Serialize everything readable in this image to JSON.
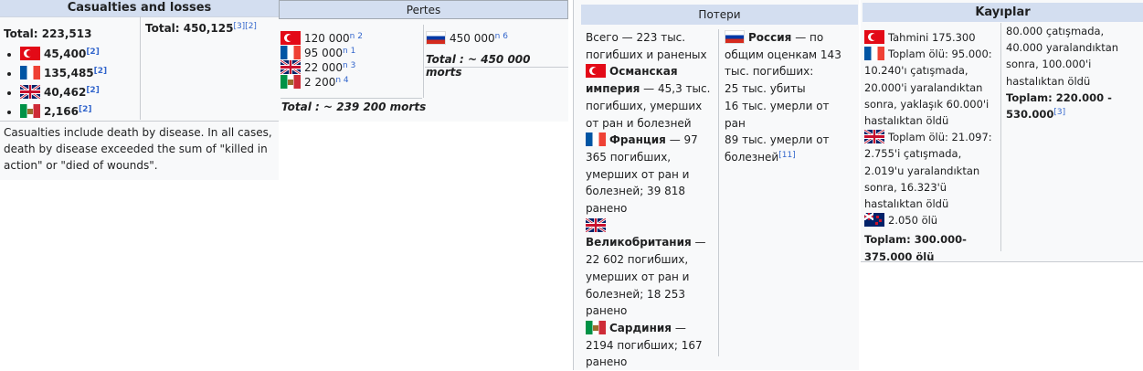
{
  "en": {
    "title": "Casualties and losses",
    "total_left_label": "Total:",
    "total_left_value": "223,513",
    "total_right_label": "Total:",
    "total_right_value": "450,125",
    "total_right_refs": "[3][2]",
    "rows": [
      {
        "flag": "turkey-flag",
        "value": "45,400",
        "ref": "[2]"
      },
      {
        "flag": "france-flag",
        "value": "135,485",
        "ref": "[2]"
      },
      {
        "flag": "uk-flag",
        "value": "40,462",
        "ref": "[2]"
      },
      {
        "flag": "sardinia-flag",
        "value": "2,166",
        "ref": "[2]"
      }
    ],
    "note": "Casualties include death by disease. In all cases, death by disease exceeded the sum of \"killed in action\" or \"died of wounds\"."
  },
  "fr": {
    "title": "Pertes",
    "rows": [
      {
        "flag": "turkey-flag",
        "value": "120 000",
        "ref": "n 2"
      },
      {
        "flag": "france-flag",
        "value": "95 000",
        "ref": "n 1"
      },
      {
        "flag": "uk-flag",
        "value": "22 000",
        "ref": "n 3"
      },
      {
        "flag": "sardinia-flag",
        "value": "2 200",
        "ref": "n 4"
      }
    ],
    "russia": {
      "flag": "russia-flag",
      "value": "450 000",
      "ref": "n 6"
    },
    "total_left": "Total : ~ 239 200 morts",
    "total_right": "Total : ~ 450 000 morts"
  },
  "ru": {
    "title": "Потери",
    "allies_total": "Всего — 223 тыс. погибших и раненых",
    "ottoman_name": "Османская империя",
    "ottoman_text": " — 45,3 тыс. погибших, умерших от ран и болезней",
    "france_name": "Франция",
    "france_text": " — 97 365 погибших, умерших от ран и болезней; 39 818 ранено",
    "uk_name": "Великобритания",
    "uk_text": " — 22 602 погибших, умерших от ран и болезней; 18 253 ранено",
    "sardinia_name": "Сардиния",
    "sardinia_text": " — 2194 погибших; 167 ранено",
    "russia_name": "Россия",
    "russia_text": " — по общим оценкам 143 тыс. погибших:",
    "russia_l1": "25 тыс. убиты",
    "russia_l2": "16 тыс. умерли от ран",
    "russia_l3": "89 тыс. умерли от болезней",
    "russia_ref": "[11]"
  },
  "tr": {
    "title": "Kayıplar",
    "ottoman": "Tahmini 175.300",
    "france": "Toplam ölü: 95.000: 10.240'ı çatışmada, 20.000'i yaralandıktan sonra, yaklaşık 60.000'i hastalıktan öldü",
    "uk": "Toplam ölü: 21.097: 2.755'i çatışmada, 2.019'u yaralandıktan sonra, 16.323'ü hastalıktan öldü",
    "nz": "2.050 ölü",
    "total_left": "Toplam: 300.000-375.000 ölü",
    "russia": "80.000 çatışmada, 40.000 yaralandıktan sonra, 100.000'i hastalıktan öldü",
    "total_right": "Toplam: 220.000 - 530.000",
    "total_right_ref": "[3]"
  }
}
